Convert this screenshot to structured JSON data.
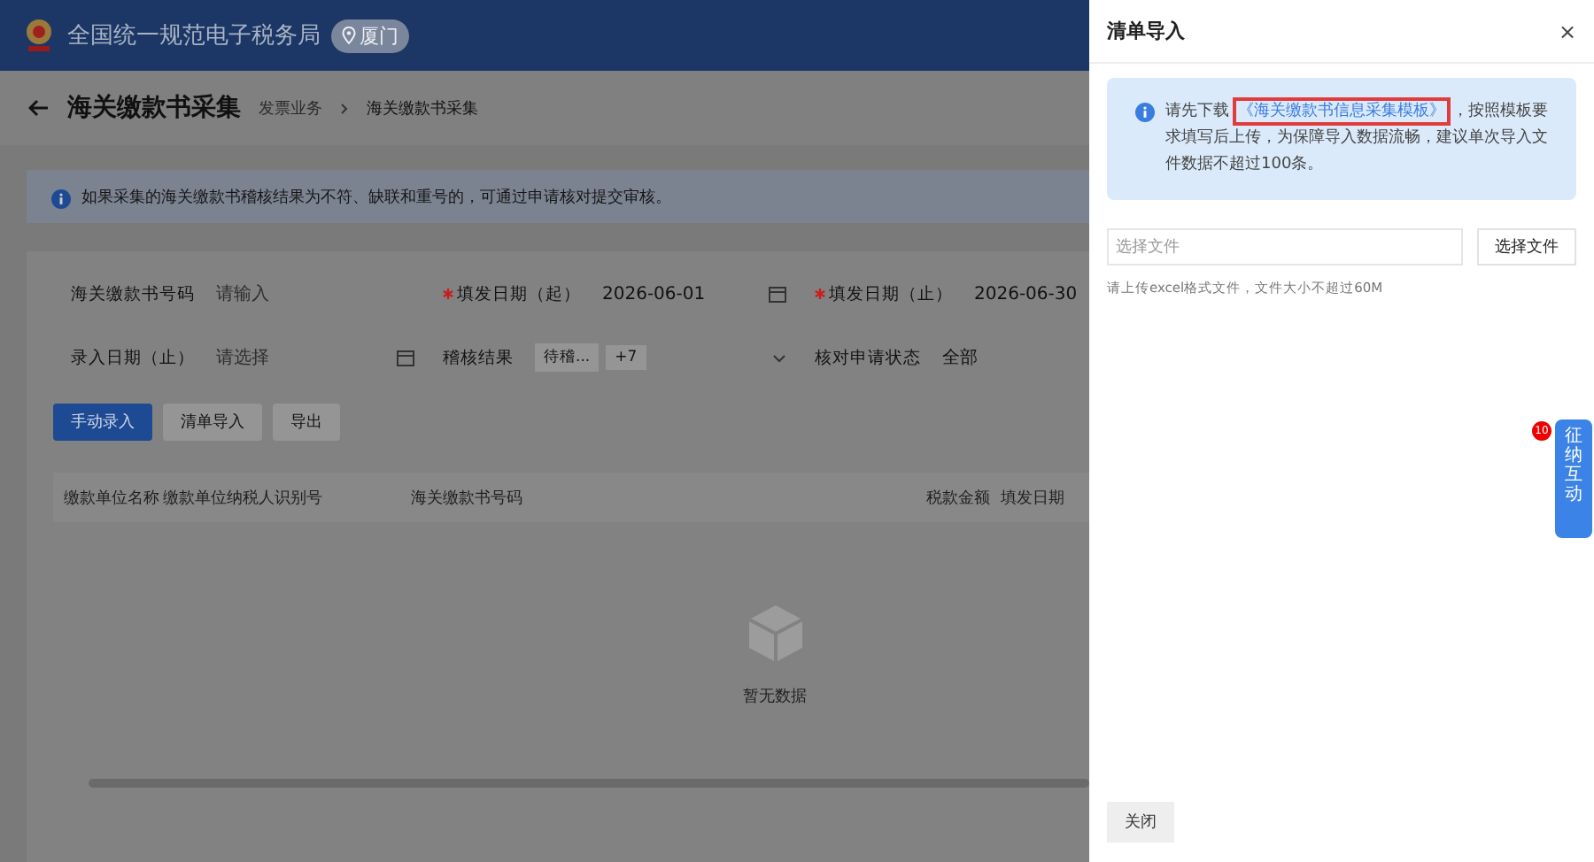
{
  "header": {
    "title": "全国统一规范电子税务局",
    "region": "厦门"
  },
  "page": {
    "title": "海关缴款书采集",
    "breadcrumb": [
      "发票业务",
      "海关缴款书采集"
    ]
  },
  "notice": "如果采集的海关缴款书稽核结果为不符、缺联和重号的，可通过申请核对提交审核。",
  "filters": [
    {
      "kind": "input",
      "label": "海关缴款书号码",
      "required": false,
      "placeholder": "请输入"
    },
    {
      "kind": "date",
      "label": "填发日期（起）",
      "required": true,
      "value": "2026-06-01"
    },
    {
      "kind": "date",
      "label": "填发日期（止）",
      "required": true,
      "value": "2026-06-30"
    },
    {
      "kind": "date",
      "label": "录入日期（止）",
      "required": false,
      "placeholder": "请选择"
    },
    {
      "kind": "tags",
      "label": "稽核结果",
      "required": false,
      "tags": [
        "待稽...",
        "+7"
      ]
    },
    {
      "kind": "select",
      "label": "核对申请状态",
      "required": false,
      "value": "全部"
    }
  ],
  "actions": [
    {
      "label": "手动录入",
      "primary": true
    },
    {
      "label": "清单导入",
      "primary": false
    },
    {
      "label": "导出",
      "primary": false
    }
  ],
  "table": {
    "columns": [
      "缴款单位名称",
      "缴款单位纳税人识别号",
      "海关缴款书号码",
      "税款金额",
      "填发日期"
    ],
    "empty_text": "暂无数据"
  },
  "drawer": {
    "title": "清单导入",
    "close": "×",
    "info_before": "请先下载",
    "info_link": "《海关缴款书信息采集模板》",
    "info_after": "，按照模板要求填写后上传，为保障导入数据流畅，建议单次导入文件数据不超过100条。",
    "file_placeholder": "选择文件",
    "file_button": "选择文件",
    "hint": "请上传excel格式文件，文件大小不超过60M",
    "footer_button": "关闭"
  },
  "float_tab": {
    "label": "征纳互动",
    "badge": "10"
  }
}
